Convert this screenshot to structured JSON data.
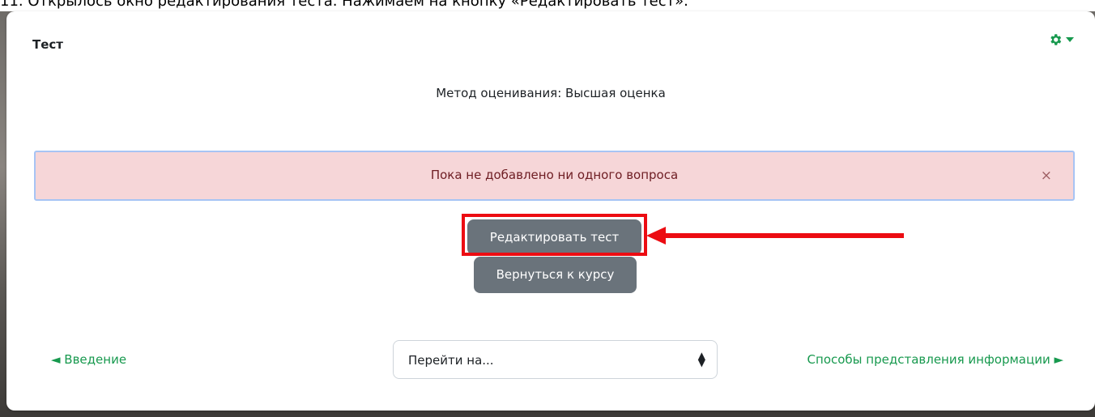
{
  "caption": "11. Открылось окно редактирования теста. Нажимаем на кнопку «Редактировать тест».",
  "card": {
    "title": "Тест",
    "grading_method": "Метод оценивания: Высшая оценка"
  },
  "alert": {
    "message": "Пока не добавлено ни одного вопроса",
    "close": "×"
  },
  "buttons": {
    "edit": "Редактировать тест",
    "back": "Вернуться к курсу"
  },
  "navigation": {
    "prev": "◄ Введение",
    "jump_placeholder": "Перейти на...",
    "next": "Способы представления информации ►"
  },
  "icons": {
    "gear": "gear-icon",
    "caret": "caret-down-icon",
    "select_arrows": "select-arrows-icon",
    "annotation_arrow": "arrow-left-icon"
  },
  "colors": {
    "accent_green": "#17994e",
    "button_gray": "#6a737b",
    "alert_bg": "#f6d6d8",
    "annotation_red": "#ec0c12"
  }
}
